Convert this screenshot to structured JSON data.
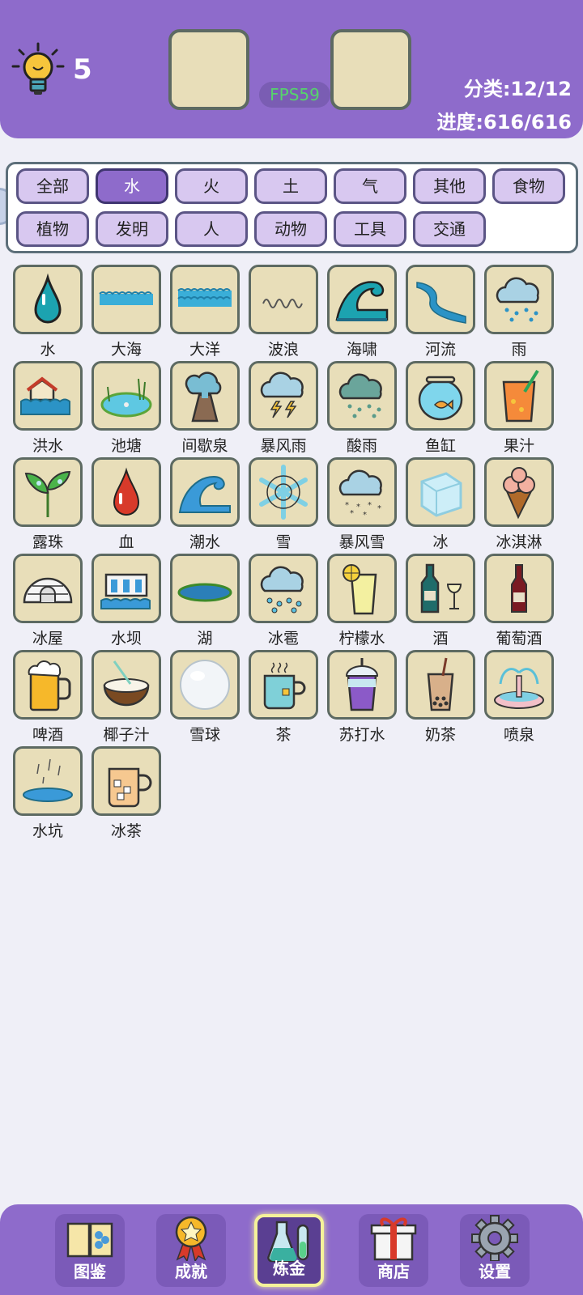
{
  "header": {
    "hint_count": "5",
    "fps": "FPS59",
    "category_stat": "分类:12/12",
    "progress_stat": "进度:616/616"
  },
  "categories": [
    "全部",
    "水",
    "火",
    "土",
    "气",
    "其他",
    "食物",
    "植物",
    "发明",
    "人",
    "动物",
    "工具",
    "交通"
  ],
  "active_category": "水",
  "items": [
    {
      "label": "水",
      "icon": "water-drop-icon"
    },
    {
      "label": "大海",
      "icon": "sea-icon"
    },
    {
      "label": "大洋",
      "icon": "ocean-icon"
    },
    {
      "label": "波浪",
      "icon": "wave-icon"
    },
    {
      "label": "海啸",
      "icon": "tsunami-icon"
    },
    {
      "label": "河流",
      "icon": "river-icon"
    },
    {
      "label": "雨",
      "icon": "rain-icon"
    },
    {
      "label": "洪水",
      "icon": "flood-icon"
    },
    {
      "label": "池塘",
      "icon": "pond-icon"
    },
    {
      "label": "间歇泉",
      "icon": "geyser-icon"
    },
    {
      "label": "暴风雨",
      "icon": "storm-icon"
    },
    {
      "label": "酸雨",
      "icon": "acid-rain-icon"
    },
    {
      "label": "鱼缸",
      "icon": "fishbowl-icon"
    },
    {
      "label": "果汁",
      "icon": "juice-icon"
    },
    {
      "label": "露珠",
      "icon": "dew-icon"
    },
    {
      "label": "血",
      "icon": "blood-drop-icon"
    },
    {
      "label": "潮水",
      "icon": "tide-icon"
    },
    {
      "label": "雪",
      "icon": "snowflake-icon"
    },
    {
      "label": "暴风雪",
      "icon": "blizzard-icon"
    },
    {
      "label": "冰",
      "icon": "ice-cube-icon"
    },
    {
      "label": "冰淇淋",
      "icon": "ice-cream-icon"
    },
    {
      "label": "冰屋",
      "icon": "igloo-icon"
    },
    {
      "label": "水坝",
      "icon": "dam-icon"
    },
    {
      "label": "湖",
      "icon": "lake-icon"
    },
    {
      "label": "冰雹",
      "icon": "hail-icon"
    },
    {
      "label": "柠檬水",
      "icon": "lemonade-icon"
    },
    {
      "label": "酒",
      "icon": "wine-bottle-glass-icon"
    },
    {
      "label": "葡萄酒",
      "icon": "wine-bottle-icon"
    },
    {
      "label": "啤酒",
      "icon": "beer-icon"
    },
    {
      "label": "椰子汁",
      "icon": "coconut-icon"
    },
    {
      "label": "雪球",
      "icon": "snowball-icon"
    },
    {
      "label": "茶",
      "icon": "tea-cup-icon"
    },
    {
      "label": "苏打水",
      "icon": "soda-icon"
    },
    {
      "label": "奶茶",
      "icon": "bubble-tea-icon"
    },
    {
      "label": "喷泉",
      "icon": "fountain-icon"
    },
    {
      "label": "水坑",
      "icon": "puddle-icon"
    },
    {
      "label": "冰茶",
      "icon": "iced-tea-icon"
    }
  ],
  "nav": [
    {
      "label": "图鉴",
      "icon": "book-icon"
    },
    {
      "label": "成就",
      "icon": "medal-icon"
    },
    {
      "label": "炼金",
      "icon": "flask-icon"
    },
    {
      "label": "商店",
      "icon": "gift-icon"
    },
    {
      "label": "设置",
      "icon": "gear-icon"
    }
  ],
  "active_nav": "炼金",
  "colors": {
    "header_bg": "#8e6bcb",
    "tile_bg": "#e8deb9",
    "tile_border": "#5d6a62",
    "category_bg": "#d8c8f0",
    "category_active_bg": "#8e6bcb",
    "fps_text": "#56d36c"
  }
}
